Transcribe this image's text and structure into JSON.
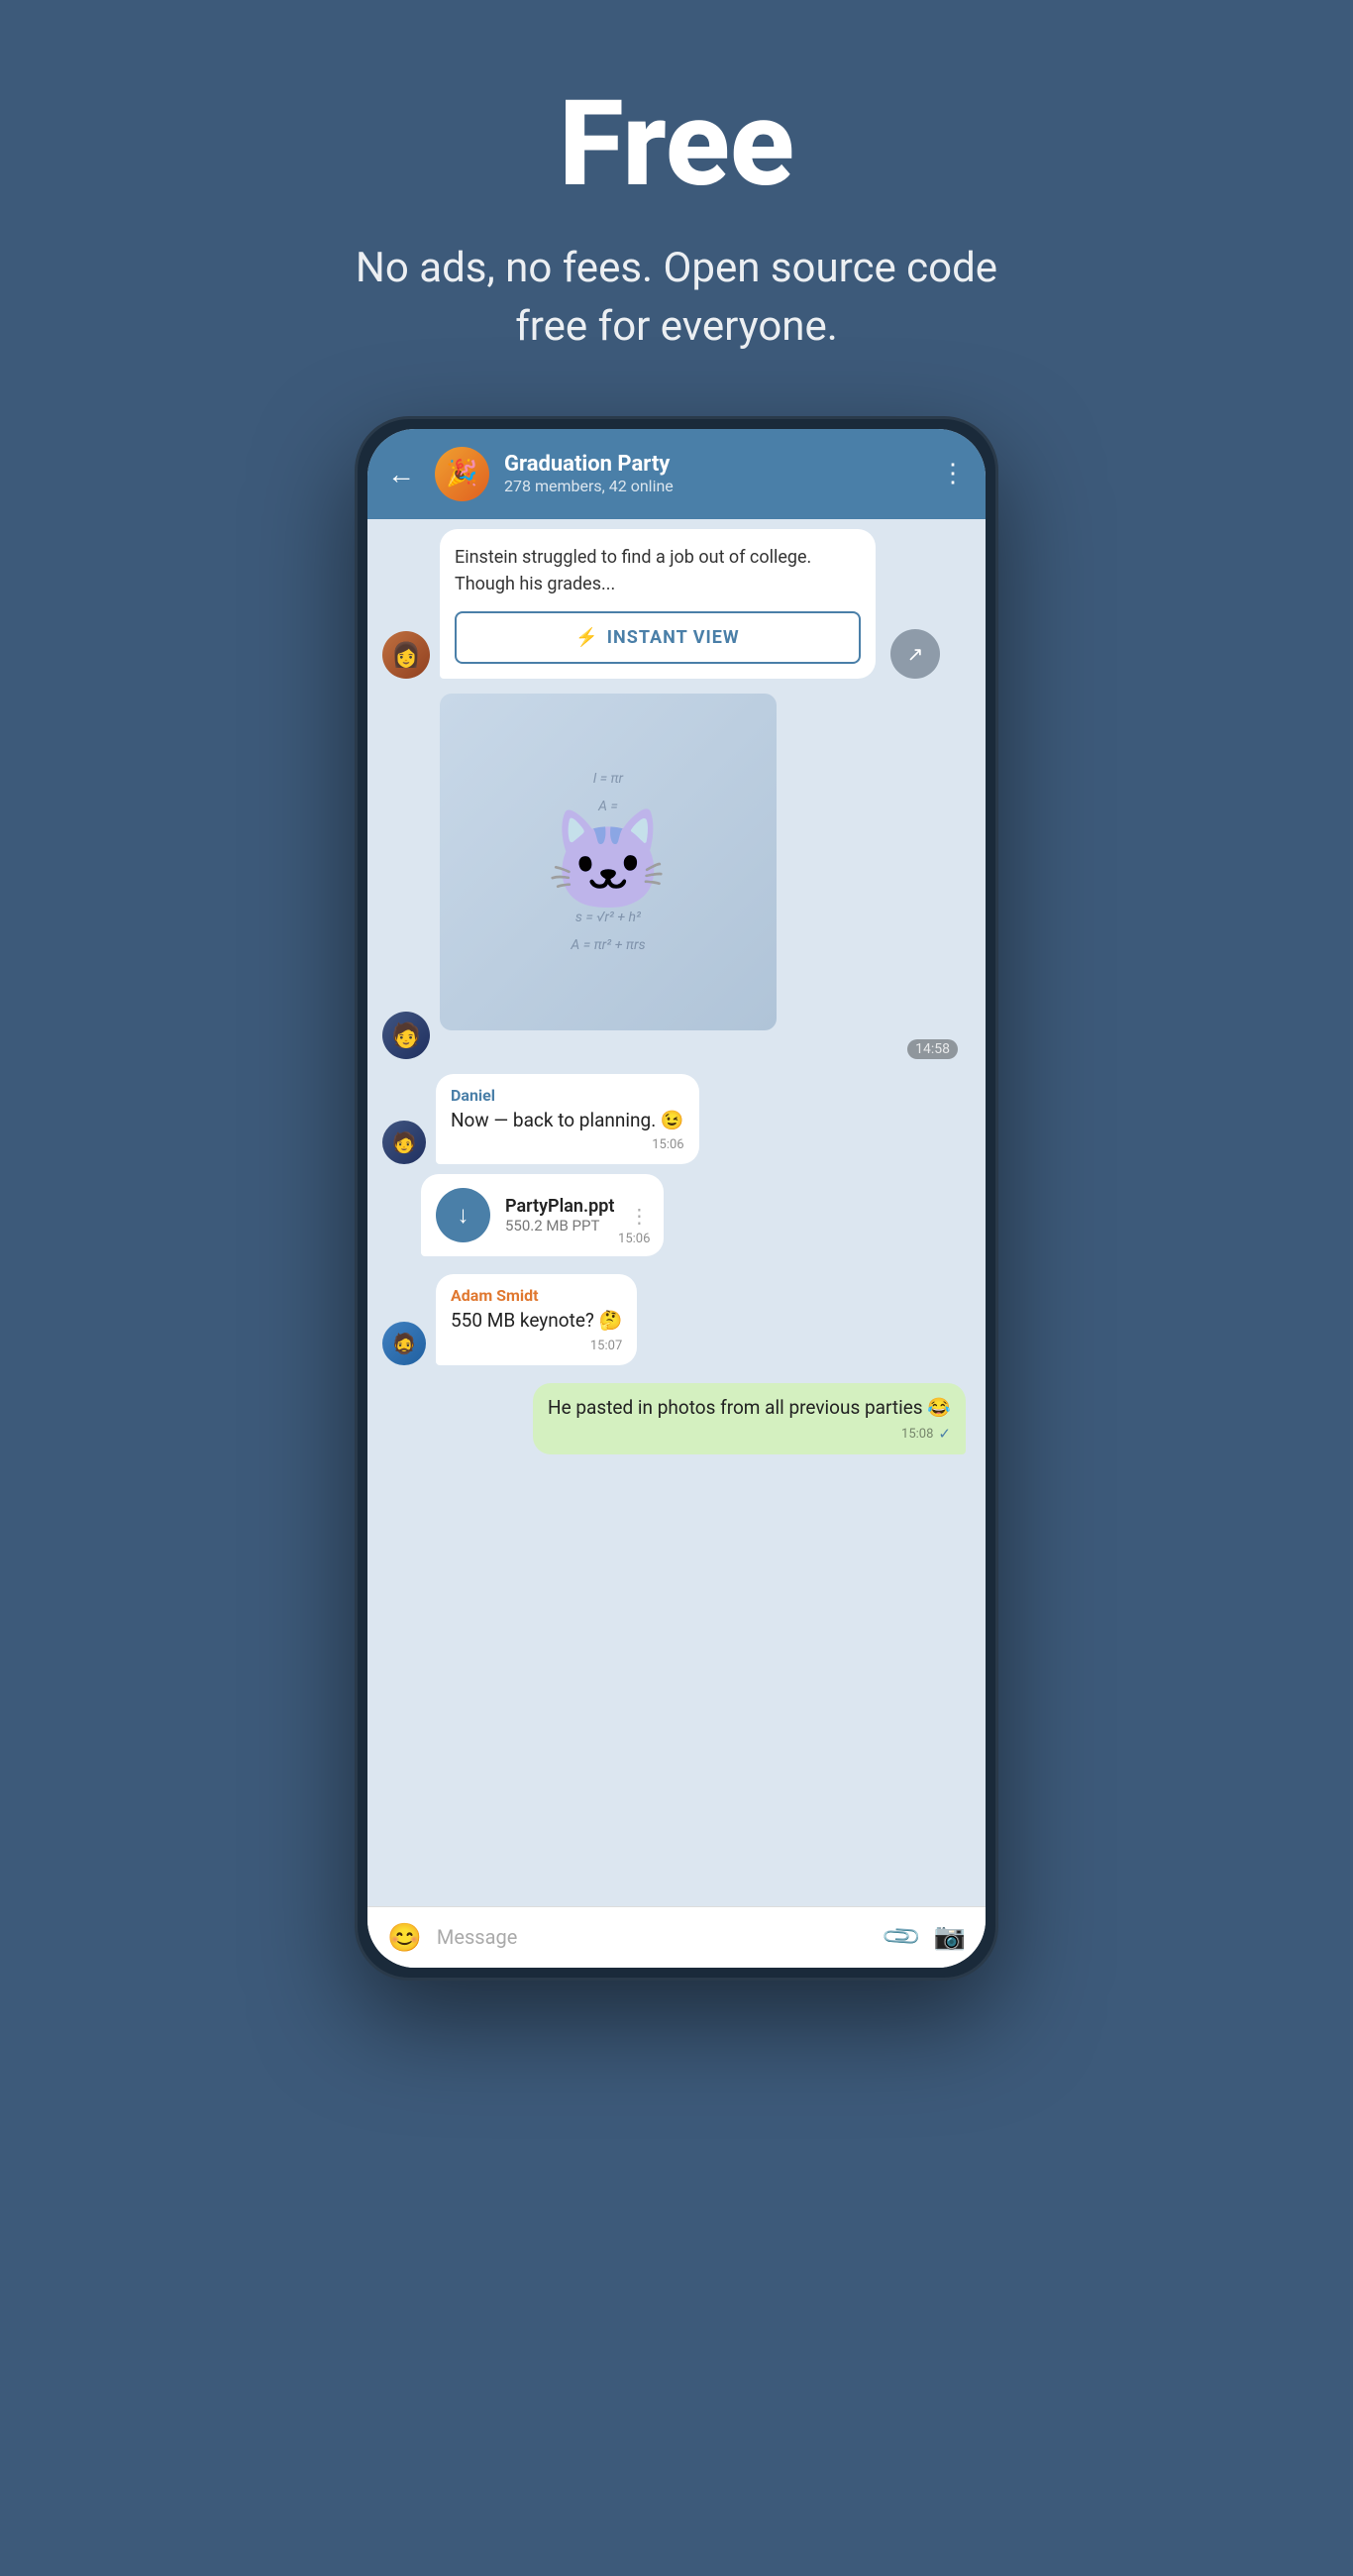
{
  "hero": {
    "title": "Free",
    "subtitle": "No ads, no fees. Open source code free for everyone."
  },
  "chat": {
    "group_name": "Graduation Party",
    "group_meta": "278 members, 42 online",
    "back_label": "←",
    "more_label": "⋮",
    "article": {
      "text": "Einstein struggled to find a job out of college. Though his grades...",
      "instant_view_label": "INSTANT VIEW"
    },
    "sticker": {
      "time": "14:58"
    },
    "messages": [
      {
        "id": "msg1",
        "type": "text",
        "sender": "Daniel",
        "sender_color": "blue",
        "text": "Now — back to planning. 😉",
        "time": "15:06",
        "direction": "incoming"
      },
      {
        "id": "msg2",
        "type": "file",
        "sender": "",
        "file_name": "PartyPlan.ppt",
        "file_size": "550.2 MB PPT",
        "time": "15:06",
        "direction": "incoming"
      },
      {
        "id": "msg3",
        "type": "text",
        "sender": "Adam Smidt",
        "sender_color": "orange",
        "text": "550 MB keynote? 🤔",
        "time": "15:07",
        "direction": "incoming"
      },
      {
        "id": "msg4",
        "type": "text",
        "sender": "",
        "text": "He pasted in photos from all previous parties 😂",
        "time": "15:08",
        "direction": "outgoing",
        "checkmark": "✓"
      }
    ],
    "input": {
      "placeholder": "Message",
      "emoji_icon": "😊",
      "attach_icon": "📎",
      "camera_icon": "📷"
    }
  }
}
